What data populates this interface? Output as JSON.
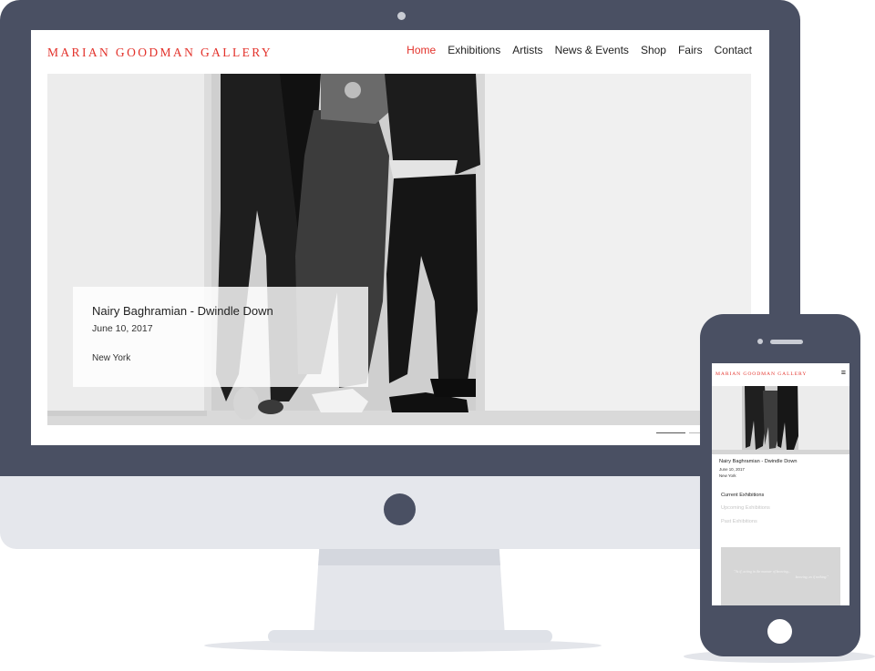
{
  "desktop": {
    "logo": "MARIAN GOODMAN GALLERY",
    "nav": {
      "home": "Home",
      "exhibitions": "Exhibitions",
      "artists": "Artists",
      "news_events": "News & Events",
      "shop": "Shop",
      "fairs": "Fairs",
      "contact": "Contact"
    },
    "feature": {
      "title": "Nairy Baghramian - Dwindle Down",
      "date": "June 10, 2017",
      "location": "New York"
    }
  },
  "mobile": {
    "logo": "MARIAN GOODMAN GALLERY",
    "menu_icon": "≡",
    "feature": {
      "title": "Nairy Baghramian - Dwindle Down",
      "date": "June 10, 2017",
      "location": "New York"
    },
    "links": {
      "current": "Current Exhibitions",
      "upcoming": "Upcoming Exhibitions",
      "past": "Past Exhibitions"
    },
    "quote": {
      "line1": "\"As if, acting in the manner of knowing...",
      "line2": "knowing, as if nothing.\""
    }
  },
  "colors": {
    "device": "#4a5063",
    "device_light": "#e5e7ec",
    "brand_red": "#e3322b"
  }
}
